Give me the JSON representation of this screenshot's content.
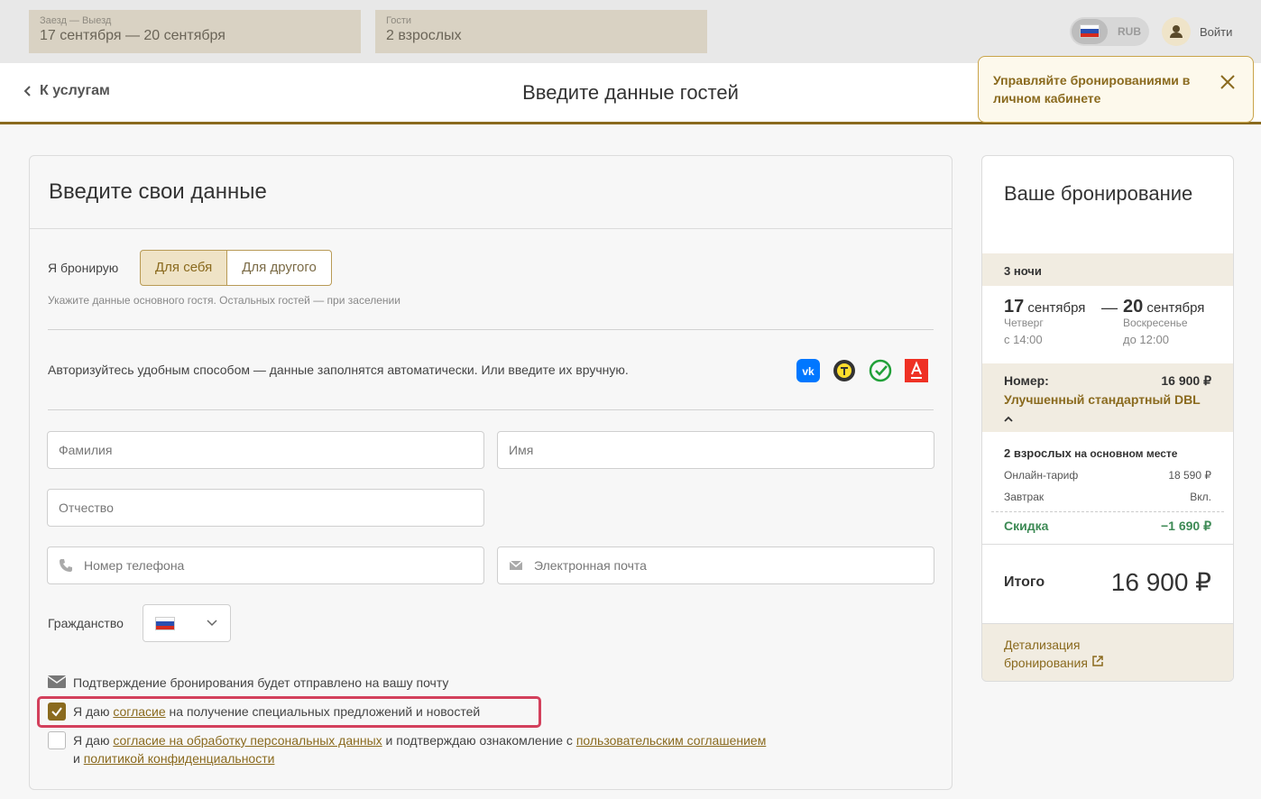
{
  "search": {
    "dates_label": "Заезд — Выезд",
    "dates_value": "17 сентября — 20 сентября",
    "guests_label": "Гости",
    "guests_value": "2 взрослых"
  },
  "topbar": {
    "currency": "RUB",
    "login_label": "Войти"
  },
  "header": {
    "back_label": "К услугам",
    "title": "Введите данные гостей"
  },
  "tooltip": {
    "text": "Управляйте бронированиями в личном кабинете"
  },
  "form": {
    "title": "Введите свои данные",
    "booking_for_label": "Я бронирую",
    "for_self": "Для себя",
    "for_other": "Для другого",
    "hint": "Укажите данные основного гостя. Остальных гостей — при заселении",
    "auth_text": "Авторизуйтесь удобным способом — данные заполнятся автоматически. Или введите их вручную.",
    "social": [
      "vk-icon",
      "tinkoff-icon",
      "sber-icon",
      "alfa-icon"
    ],
    "placeholders": {
      "last_name": "Фамилия",
      "first_name": "Имя",
      "middle_name": "Отчество",
      "phone": "Номер телефона",
      "email": "Электронная почта"
    },
    "citizenship_label": "Гражданство",
    "confirm_note": "Подтверждение бронирования будет отправлено на вашу почту",
    "consent1": {
      "pre": "Я даю ",
      "link": "согласие",
      "post": " на получение специальных предложений и новостей",
      "checked": true
    },
    "consent2": {
      "pre": "Я даю ",
      "link1": "согласие на обработку персональных данных",
      "mid": " и подтверждаю ознакомление с ",
      "link2": "пользовательским соглашением",
      "and": "и ",
      "link3": "политикой конфиденциальности",
      "checked": false
    }
  },
  "summary": {
    "title": "Ваше бронирование",
    "nights": "3 ночи",
    "checkin_day": "17",
    "checkin_month": "сентября",
    "dash": "—",
    "checkout_day": "20",
    "checkout_month": "сентября",
    "checkin_weekday": "Четверг",
    "checkin_time": "с 14:00",
    "checkout_weekday": "Воскресенье",
    "checkout_time": "до 12:00",
    "room_label": "Номер:",
    "room_price": "16 900 ₽",
    "room_name": "Улучшенный стандартный DBL",
    "guests_bold": "2 взрослых",
    "guests_rest": " на основном месте",
    "tariff_label": "Онлайн-тариф",
    "tariff_value": "18 590 ₽",
    "breakfast_label": "Завтрак",
    "breakfast_value": "Вкл.",
    "discount_label": "Скидка",
    "discount_value": "−1 690 ₽",
    "total_label": "Итого",
    "total_value": "16 900 ₽",
    "details_link": "Детализация бронирования"
  },
  "colors": {
    "accent": "#8a6a1e",
    "highlight": "#d3405c",
    "discount": "#3d8a55"
  }
}
